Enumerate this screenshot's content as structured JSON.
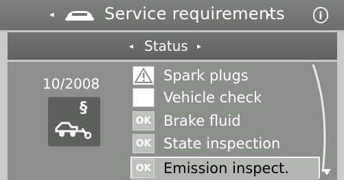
{
  "header": {
    "title": "Service requirements",
    "prev_arrow": "◂",
    "next_arrow": "▸",
    "info_symbol": "i"
  },
  "status_bar": {
    "title": "Status",
    "prev_arrow": "◂",
    "next_arrow": "▸"
  },
  "next_service": {
    "date": "10/2008",
    "section_symbol": "§"
  },
  "service_items": [
    {
      "label": "Spark plugs",
      "status": "warning",
      "icon": "warning-triangle-icon"
    },
    {
      "label": "Vehicle check",
      "status": "due",
      "icon": "blank-status-icon"
    },
    {
      "label": "Brake fluid",
      "status": "OK",
      "icon": "ok-badge-icon"
    },
    {
      "label": "State inspection",
      "status": "OK",
      "icon": "ok-badge-icon"
    },
    {
      "label": "Emission inspect.",
      "status": "OK",
      "icon": "ok-badge-icon",
      "selected": true
    }
  ],
  "colors": {
    "top_bar": "#737572",
    "status_bar": "#686a67",
    "main_panel": "#8c8f8c",
    "text": "#ffffff",
    "selection_bg": "#b3b5b2"
  }
}
